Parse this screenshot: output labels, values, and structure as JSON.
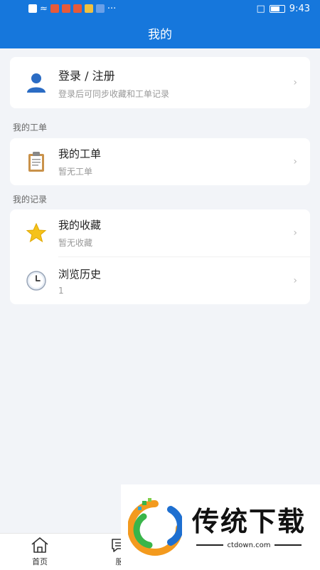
{
  "status_bar": {
    "time": "9:43",
    "dots": "···"
  },
  "nav": {
    "title": "我的"
  },
  "login_card": {
    "title": "登录 / 注册",
    "subtitle": "登录后可同步收藏和工单记录",
    "icon": "user-icon"
  },
  "section_tickets": {
    "label": "我的工单"
  },
  "tickets_card": {
    "title": "我的工单",
    "subtitle": "暂无工单",
    "icon": "clipboard-icon"
  },
  "section_records": {
    "label": "我的记录"
  },
  "records": [
    {
      "title": "我的收藏",
      "subtitle": "暂无收藏",
      "icon": "star-icon"
    },
    {
      "title": "浏览历史",
      "subtitle": "1",
      "icon": "clock-icon"
    }
  ],
  "tabs": [
    {
      "label": "首页",
      "icon": "home-icon"
    },
    {
      "label": "服",
      "icon": "chat-icon"
    }
  ],
  "watermark": {
    "title": "传统下载",
    "url": "ctdown.com"
  },
  "colors": {
    "primary": "#1677dc",
    "background": "#f2f4f8"
  }
}
